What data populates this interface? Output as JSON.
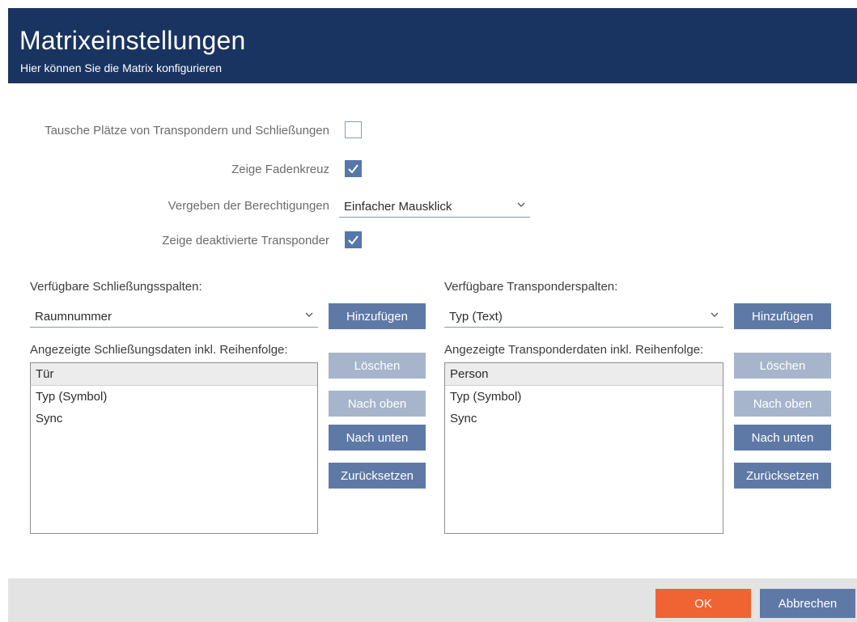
{
  "header": {
    "title": "Matrixeinstellungen",
    "subtitle": "Hier können Sie die Matrix konfigurieren"
  },
  "options": {
    "swap_label": "Tausche Plätze von Transpondern und Schließungen",
    "swap_checked": false,
    "crosshair_label": "Zeige Fadenkreuz",
    "crosshair_checked": true,
    "permissions_label": "Vergeben der Berechtigungen",
    "permissions_value": "Einfacher Mausklick",
    "deactivated_label": "Zeige deaktivierte Transponder",
    "deactivated_checked": true
  },
  "locks": {
    "available_label": "Verfügbare Schließungsspalten:",
    "available_value": "Raumnummer",
    "add_label": "Hinzufügen",
    "shown_label": "Angezeigte Schließungsdaten inkl. Reihenfolge:",
    "items": [
      "Tür",
      "Typ (Symbol)",
      "Sync"
    ],
    "delete_label": "Löschen",
    "up_label": "Nach oben",
    "down_label": "Nach unten",
    "reset_label": "Zurücksetzen"
  },
  "transponders": {
    "available_label": "Verfügbare Transponderspalten:",
    "available_value": "Typ (Text)",
    "add_label": "Hinzufügen",
    "shown_label": "Angezeigte Transponderdaten inkl. Reihenfolge:",
    "items": [
      "Person",
      "Typ (Symbol)",
      "Sync"
    ],
    "delete_label": "Löschen",
    "up_label": "Nach oben",
    "down_label": "Nach unten",
    "reset_label": "Zurücksetzen"
  },
  "footer": {
    "ok_label": "OK",
    "cancel_label": "Abbrechen"
  },
  "colors": {
    "header_bg": "#193460",
    "button": "#5f79a6",
    "button_disabled": "#a6b5cb",
    "ok": "#ef6432",
    "cancel": "#5f79a6"
  }
}
